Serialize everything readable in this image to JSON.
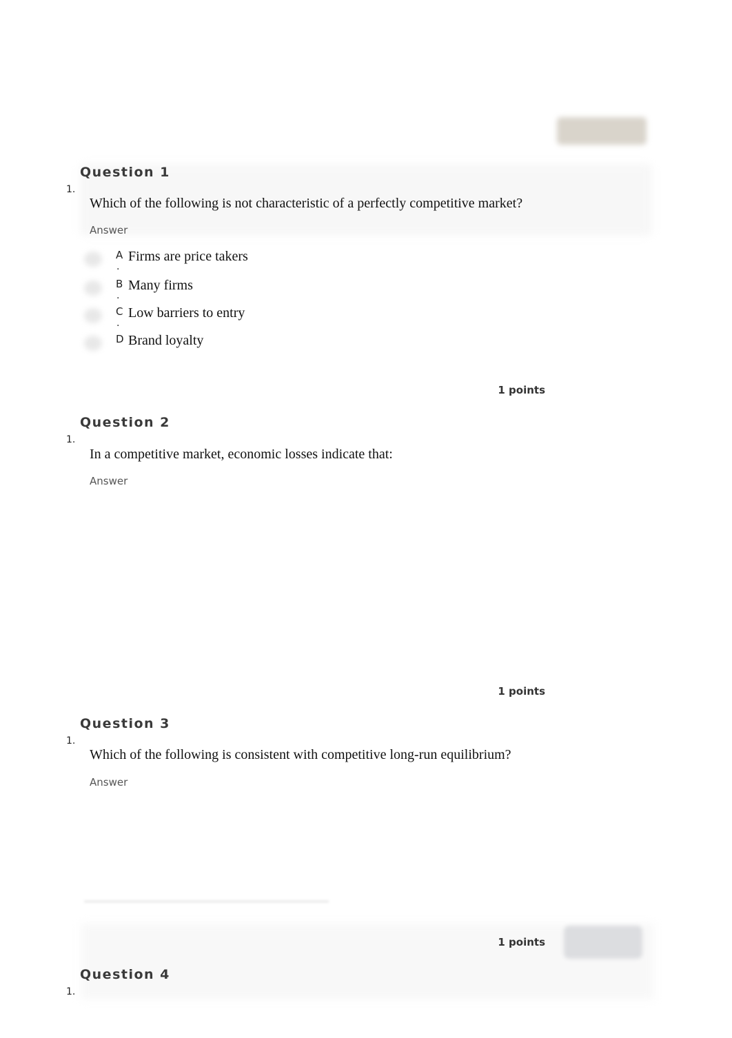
{
  "top_button": {
    "label": ""
  },
  "questions": [
    {
      "title": "Question 1",
      "number": "1.",
      "text": "Which of the following is not characteristic of a perfectly competitive market?",
      "answer_label": "Answer",
      "options": [
        {
          "letter": "A",
          "text": "Firms are price takers"
        },
        {
          "letter": "B",
          "text": "Many firms"
        },
        {
          "letter": "C",
          "text": "Low barriers to entry"
        },
        {
          "letter": "D",
          "text": "Brand loyalty"
        }
      ],
      "points": "1 points"
    },
    {
      "title": "Question 2",
      "number": "1.",
      "text": "In a competitive market, economic losses indicate that:",
      "answer_label": "Answer",
      "points": "1 points"
    },
    {
      "title": "Question 3",
      "number": "1.",
      "text": "Which of the following is consistent with competitive long-run equilibrium?",
      "answer_label": "Answer",
      "points": "1 points"
    },
    {
      "title": "Question 4",
      "number": "1."
    }
  ]
}
